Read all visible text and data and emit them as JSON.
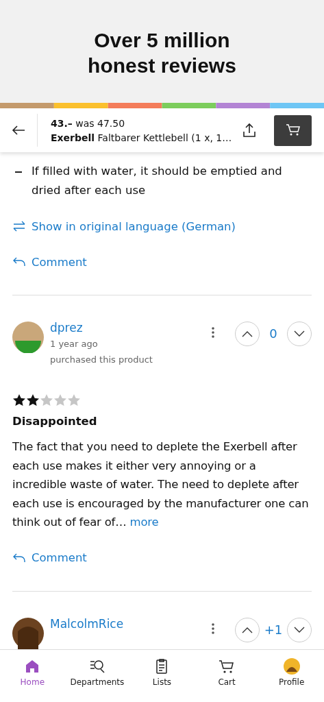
{
  "banner": {
    "lines": [
      "Over 5 million",
      "honest reviews"
    ]
  },
  "header": {
    "price": "43.–",
    "was": "was 47.50",
    "brand": "Exerbell",
    "product": "Faltbarer Kettlebell (1 x, 1…"
  },
  "previous_review": {
    "bullets": [
      "If filled with water, it should be emptied and dried after each use"
    ],
    "translate_link": "Show in original language (German)",
    "comment_link": "Comment"
  },
  "reviews": [
    {
      "user": "dprez",
      "time": "1 year ago",
      "note": "purchased this product",
      "votes": "0",
      "stars": 2,
      "title": "Disappointed",
      "body": "The fact that you need to deplete the Exerbell after each use makes it either very annoying or a incredible waste of water. The need to deplete after each use is encouraged by the manufacturer one can think out of fear of…",
      "more": "more",
      "comment_link": "Comment"
    },
    {
      "user": "MalcolmRice",
      "votes": "+1"
    }
  ],
  "nav": [
    {
      "label": "Home",
      "kind": "home",
      "selected": true
    },
    {
      "label": "Departments",
      "kind": "departments",
      "selected": false
    },
    {
      "label": "Lists",
      "kind": "lists",
      "selected": false
    },
    {
      "label": "Cart",
      "kind": "cart",
      "selected": false
    },
    {
      "label": "Profile",
      "kind": "profile",
      "selected": false
    }
  ]
}
